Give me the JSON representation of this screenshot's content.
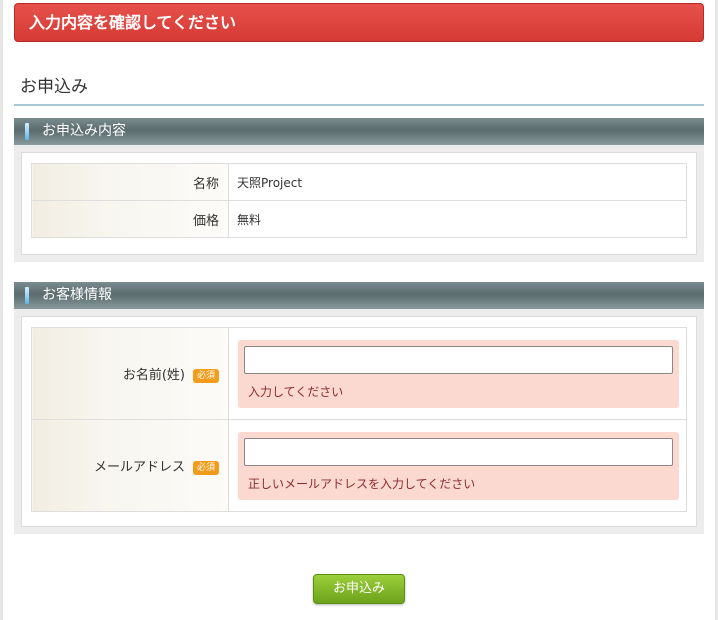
{
  "alert": {
    "message": "入力内容を確認してください"
  },
  "page": {
    "title": "お申込み"
  },
  "application_section": {
    "header": "お申込み内容",
    "rows": [
      {
        "label": "名称",
        "value": "天照Project"
      },
      {
        "label": "価格",
        "value": "無料"
      }
    ]
  },
  "customer_section": {
    "header": "お客様情報",
    "fields": [
      {
        "label": "お名前(姓)",
        "badge": "必須",
        "value": "",
        "error": "入力してください"
      },
      {
        "label": "メールアドレス",
        "badge": "必須",
        "value": "",
        "error": "正しいメールアドレスを入力してください"
      }
    ]
  },
  "submit": {
    "label": "お申込み"
  },
  "colors": {
    "alert_red": "#d63a35",
    "section_header": "#5b6b6e",
    "required_badge": "#f39b1a",
    "error_bg": "#fcd9d0",
    "submit_green": "#7db324"
  }
}
